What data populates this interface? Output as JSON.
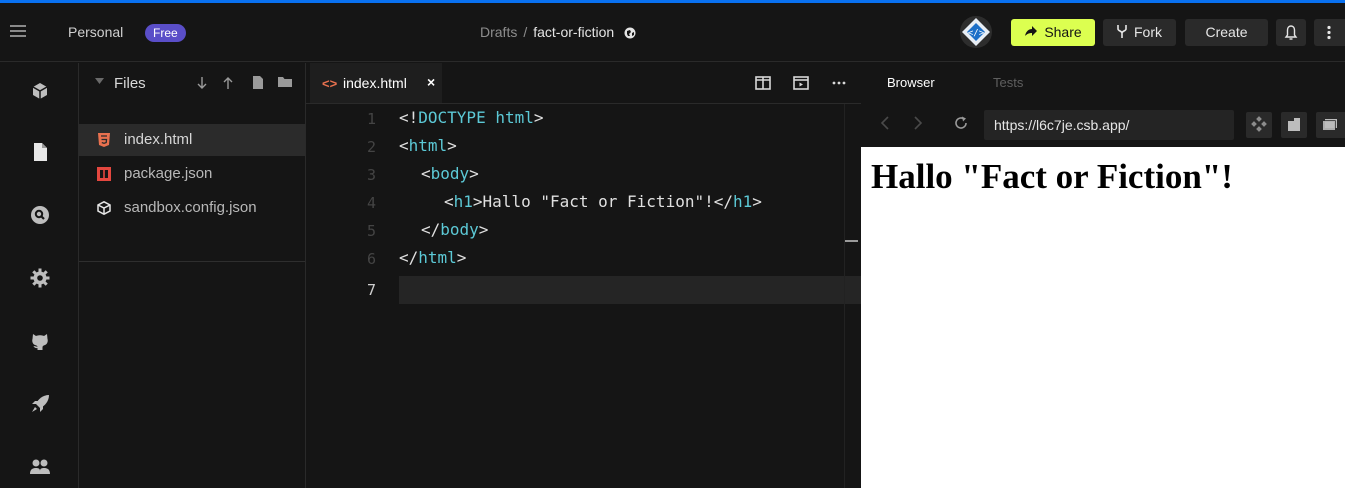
{
  "topbar": {
    "workspace": "Personal",
    "plan_badge": "Free",
    "breadcrumb_folder": "Drafts",
    "breadcrumb_separator": "/",
    "sandbox_name": "fact-or-fiction",
    "share_label": "Share",
    "fork_label": "Fork",
    "create_label": "Create"
  },
  "explorer": {
    "title": "Files",
    "files": [
      {
        "name": "index.html",
        "icon": "html5-icon",
        "active": true
      },
      {
        "name": "package.json",
        "icon": "npm-icon",
        "active": false
      },
      {
        "name": "sandbox.config.json",
        "icon": "codesandbox-cube-icon",
        "active": false
      }
    ]
  },
  "editor": {
    "tab_label": "index.html",
    "tab_icon": "<>",
    "close_symbol": "×",
    "line_numbers": [
      "1",
      "2",
      "3",
      "4",
      "5",
      "6",
      "7"
    ],
    "lines": {
      "l1": {
        "a": "<!",
        "b": "DOCTYPE html",
        "c": ">"
      },
      "l2": {
        "a": "<",
        "b": "html",
        "c": ">"
      },
      "l3": {
        "a": "<",
        "b": "body",
        "c": ">"
      },
      "l4": {
        "a": "<",
        "b": "h1",
        "c": ">Hallo \"Fact or Fiction\"!</",
        "d": "h1",
        "e": ">"
      },
      "l5": {
        "a": "</",
        "b": "body",
        "c": ">"
      },
      "l6": {
        "a": "</",
        "b": "html",
        "c": ">"
      }
    },
    "current_line": "7"
  },
  "preview": {
    "tabs": [
      "Browser",
      "Tests"
    ],
    "url": "https://l6c7je.csb.app/",
    "rendered_heading": "Hallo \"Fact or Fiction\"!"
  },
  "colors": {
    "accent_share": "#dcff50",
    "badge": "#5a4ec8",
    "html_icon": "#e9714f",
    "code_keyword": "#5cc9d6",
    "top_edge": "#0971f1"
  }
}
